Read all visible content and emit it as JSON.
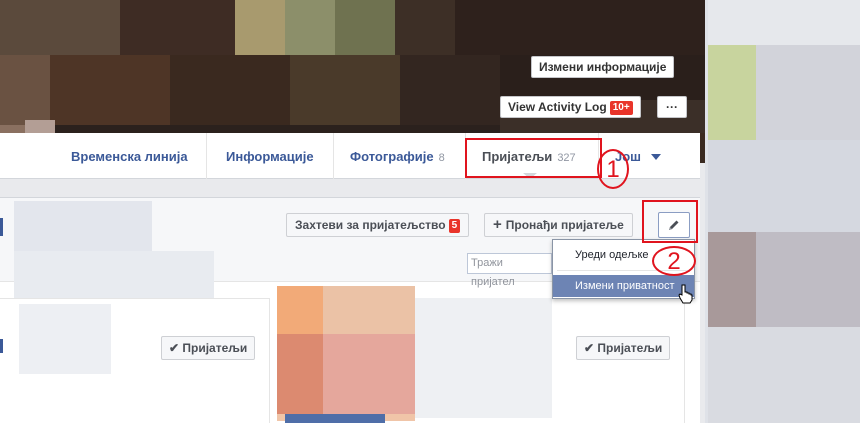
{
  "cover": {
    "edit_info_label": "Измени информације",
    "activity_log_label": "View Activity Log",
    "activity_log_badge": "10+",
    "more_label": "···"
  },
  "tabs": [
    {
      "label": "Временска линија",
      "count": ""
    },
    {
      "label": "Информације",
      "count": ""
    },
    {
      "label": "Фотографије",
      "count": "8"
    },
    {
      "label": "Пријатељи",
      "count": "327"
    },
    {
      "label": "Још",
      "count": ""
    }
  ],
  "annotations": {
    "one": "1",
    "two": "2"
  },
  "friends_panel": {
    "requests_label": "Захтеви за пријатељство",
    "requests_badge": "5",
    "find_friends_label": "Пронађи пријатеље",
    "search_placeholder": "Тражи пријател",
    "edit_icon": "pencil-icon"
  },
  "menu": {
    "items": [
      "Уреди одељке",
      "Измени приватност"
    ],
    "highlighted": "Измени приватност"
  },
  "friend_cards": [
    {
      "button_label": "Пријатељи"
    },
    {
      "button_label": "Пријатељи"
    }
  ],
  "colors": {
    "link": "#3b5998",
    "annotation": "#e0141e",
    "menu_highlight": "#6d84b4",
    "badge": "#e9342a"
  }
}
